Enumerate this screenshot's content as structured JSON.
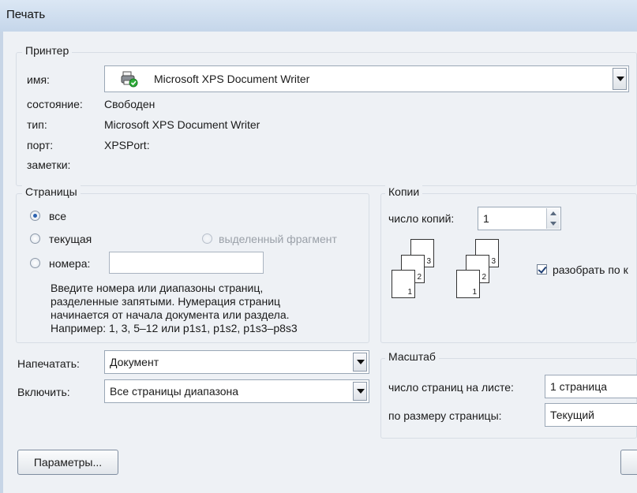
{
  "window": {
    "title": "Печать"
  },
  "printer": {
    "group_title": "Принтер",
    "name_label": "имя:",
    "name_value": "Microsoft XPS Document Writer",
    "status_label": "состояние:",
    "status_value": "Свободен",
    "type_label": "тип:",
    "type_value": "Microsoft XPS Document Writer",
    "port_label": "порт:",
    "port_value": "XPSPort:",
    "notes_label": "заметки:"
  },
  "pages": {
    "group_title": "Страницы",
    "all_label": "все",
    "current_label": "текущая",
    "selection_label": "выделенный фрагмент",
    "numbers_label": "номера:",
    "numbers_value": "",
    "hint_line1": "Введите номера или диапазоны страниц,",
    "hint_line2": "разделенные запятыми. Нумерация страниц",
    "hint_line3": "начинается от начала документа или раздела.",
    "hint_line4": "Например: 1, 3, 5–12 или p1s1, p1s2, p1s3–p8s3",
    "selected": "all"
  },
  "copies": {
    "group_title": "Копии",
    "count_label": "число копий:",
    "count_value": "1",
    "collate_label": "разобрать по к",
    "collate_checked": true,
    "page_numbers": [
      "1",
      "2",
      "3"
    ]
  },
  "print_what": {
    "label": "Напечатать:",
    "value": "Документ"
  },
  "include": {
    "label": "Включить:",
    "value": "Все страницы диапазона"
  },
  "zoom": {
    "group_title": "Масштаб",
    "pages_per_sheet_label": "число страниц на листе:",
    "pages_per_sheet_value": "1 страница",
    "scale_label": "по размеру страницы:",
    "scale_value": "Текущий"
  },
  "buttons": {
    "options_label": "Параметры..."
  }
}
